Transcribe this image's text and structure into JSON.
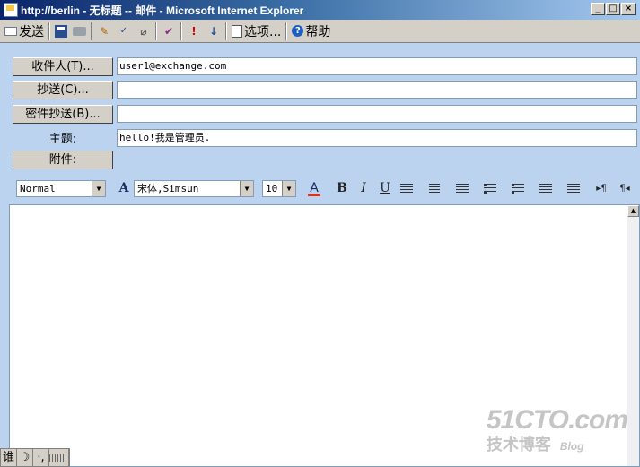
{
  "window": {
    "title": "http://berlin - 无标题 -- 邮件 - Microsoft Internet Explorer",
    "controls": {
      "minimize": "_",
      "maximize": "□",
      "close": "×"
    }
  },
  "toolbar": {
    "send_label": "发送",
    "options_label": "选项...",
    "help_label": "帮助",
    "icons": [
      "send-icon",
      "save-icon",
      "print-icon",
      "edit-icon",
      "spellcheck-icon",
      "attach-icon",
      "check-names-icon",
      "high-importance-icon",
      "low-importance-icon",
      "options-icon",
      "help-icon"
    ]
  },
  "address": {
    "to_button": "收件人(T)...",
    "to_value": "user1@exchange.com",
    "cc_button": "抄送(C)...",
    "cc_value": "",
    "bcc_button": "密件抄送(B)...",
    "bcc_value": "",
    "subject_label": "主题:",
    "subject_value": "hello!我是管理员.",
    "attach_button": "附件:"
  },
  "format": {
    "style": "Normal",
    "font": "宋体,Simsun",
    "size": "10",
    "font_color": "#e0311e"
  },
  "editor": {
    "body": ""
  },
  "ime": {
    "mode": "谁",
    "moon": "☽",
    "punct": "·,",
    "keyboard": "keyboard-icon"
  },
  "watermark": {
    "brand": "51CTO.com",
    "sub": "技术博客",
    "blog": "Blog"
  },
  "colors": {
    "title_start": "#0a246a",
    "title_end": "#a6caf0",
    "panel": "#bcd3f0",
    "chrome": "#d4d0c8"
  }
}
